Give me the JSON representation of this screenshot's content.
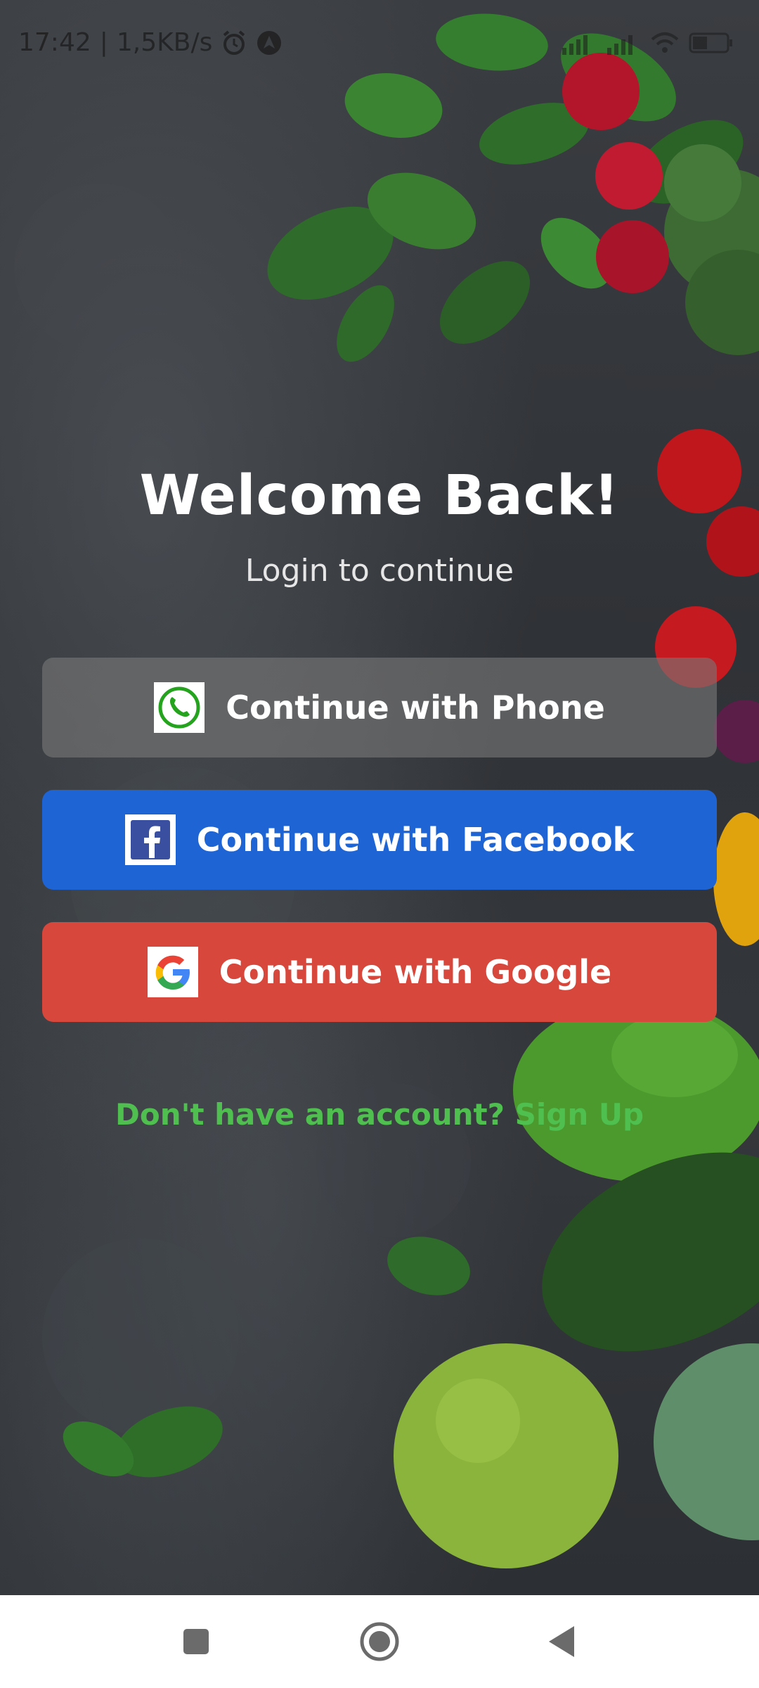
{
  "status_bar": {
    "time": "17:42",
    "network_speed": "1,5KB/s",
    "left_icons": [
      "alarm-icon",
      "navigation-icon"
    ],
    "right_icons": [
      "signal-icon",
      "signal-icon",
      "wifi-icon",
      "battery-icon"
    ]
  },
  "login": {
    "title": "Welcome Back!",
    "subtitle": "Login to continue",
    "buttons": [
      {
        "label": "Continue with Phone",
        "icon": "phone-icon",
        "color": "#7a7a7a"
      },
      {
        "label": "Continue with Facebook",
        "icon": "facebook-icon",
        "color": "#1e64d4"
      },
      {
        "label": "Continue with Google",
        "icon": "google-icon",
        "color": "#d7473b"
      }
    ],
    "signup_text": "Don't have an account? Sign Up",
    "signup_color": "#4fbf4f"
  },
  "nav_bar": {
    "buttons": [
      "recent-apps-icon",
      "home-icon",
      "back-icon"
    ]
  }
}
